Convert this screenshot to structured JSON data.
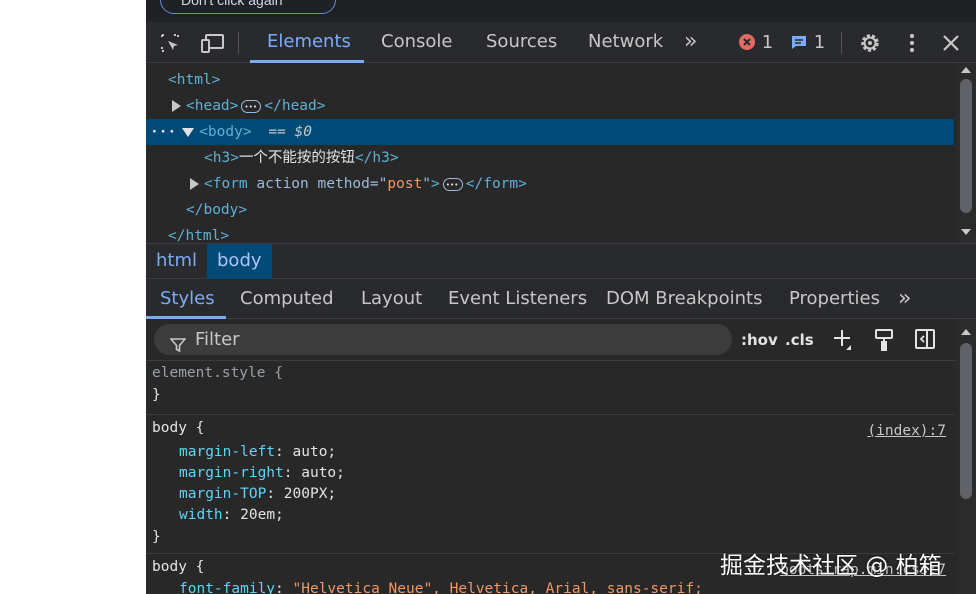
{
  "page": {
    "partial_button_label": "Don't click again"
  },
  "toolbar": {
    "tabs": [
      "Elements",
      "Console",
      "Sources",
      "Network"
    ],
    "more_tabs": "»",
    "error_count": "1",
    "message_count": "1"
  },
  "dom": {
    "html_open": "<html>",
    "head_open": "<head>",
    "head_close": "</head>",
    "body_open": "<body>",
    "body_eq": "== $0",
    "h3_open": "<h3>",
    "h3_text": "一个不能按的按钮",
    "h3_close": "</h3>",
    "form_open_tag": "<form",
    "form_attr1": "action",
    "form_attr2": "method",
    "form_attr2_value": "post",
    "form_close": "</form>",
    "body_close": "</body>",
    "html_close": "</html>"
  },
  "breadcrumbs": [
    "html",
    "body"
  ],
  "subtabs": [
    "Styles",
    "Computed",
    "Layout",
    "Event Listeners",
    "DOM Breakpoints",
    "Properties"
  ],
  "filter": {
    "placeholder": "Filter",
    "hov": ":hov",
    "cls": ".cls"
  },
  "styles": {
    "element_style_selector": "element.style {",
    "close_brace": "}",
    "rule1": {
      "selector": "body {",
      "source": "(index):7",
      "declarations": [
        {
          "prop": "margin-left",
          "value": "auto;"
        },
        {
          "prop": "margin-right",
          "value": "auto;"
        },
        {
          "prop": "margin-TOP",
          "value": "200PX;"
        },
        {
          "prop": "width",
          "value": "20em;"
        }
      ]
    },
    "rule2": {
      "selector": "body {",
      "source": "bootstrap.min.css:7",
      "declarations": [
        {
          "prop": "font-family",
          "value": "\"Helvetica Neue\", Helvetica, Arial, sans-serif;"
        }
      ]
    }
  },
  "watermark": "掘金技术社区 @ 柏箱"
}
